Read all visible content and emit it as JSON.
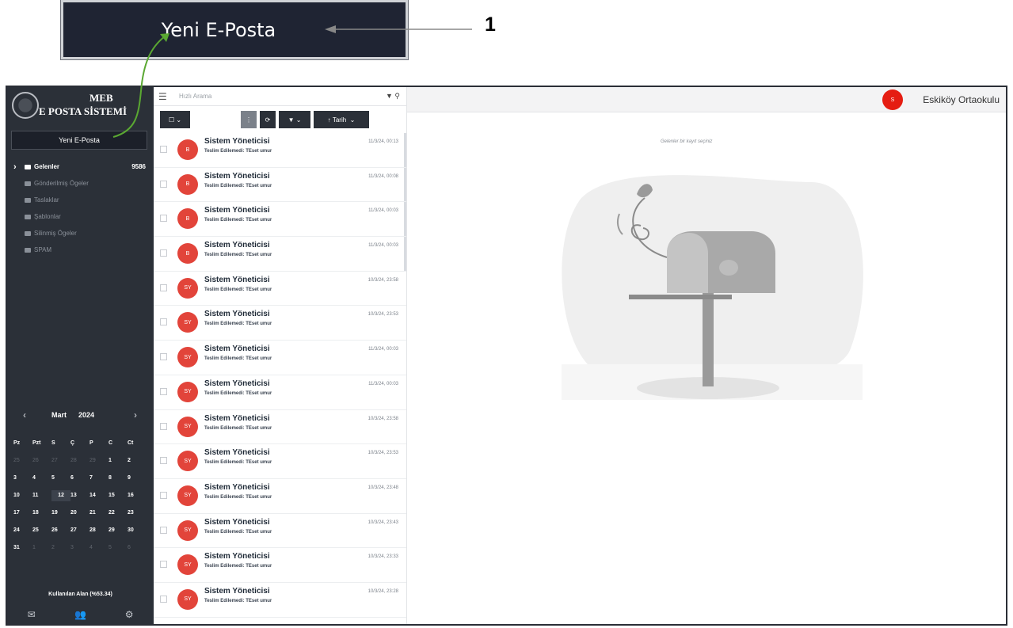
{
  "callout": {
    "button_label": "Yeni E-Posta",
    "number": "1"
  },
  "logo": {
    "line1": "MEB",
    "line2": "E POSTA SİSTEMİ"
  },
  "sidebar": {
    "new_mail_label": "Yeni E-Posta",
    "folders": [
      {
        "label": "Gelenler",
        "count": "9586",
        "icon": "inbox-icon",
        "active": true
      },
      {
        "label": "Gönderilmiş Ögeler",
        "icon": "sent-icon"
      },
      {
        "label": "Taslaklar",
        "icon": "drafts-icon"
      },
      {
        "label": "Şablonlar",
        "icon": "templates-icon"
      },
      {
        "label": "Silinmiş Ögeler",
        "icon": "trash-icon"
      },
      {
        "label": "SPAM",
        "icon": "spam-folder-icon"
      }
    ],
    "quota": "Kullanılan Alan (%53.34)"
  },
  "calendar": {
    "month": "Mart",
    "year": "2024",
    "weekdays": [
      "Pz",
      "Pzt",
      "S",
      "Ç",
      "P",
      "C",
      "Ct"
    ],
    "weeks": [
      [
        "25",
        "26",
        "27",
        "28",
        "29",
        "1",
        "2"
      ],
      [
        "3",
        "4",
        "5",
        "6",
        "7",
        "8",
        "9"
      ],
      [
        "10",
        "11",
        "12",
        "13",
        "14",
        "15",
        "16"
      ],
      [
        "17",
        "18",
        "19",
        "20",
        "21",
        "22",
        "23"
      ],
      [
        "24",
        "25",
        "26",
        "27",
        "28",
        "29",
        "30"
      ],
      [
        "31",
        "1",
        "2",
        "3",
        "4",
        "5",
        "6"
      ]
    ],
    "today": "12"
  },
  "list": {
    "search_placeholder": "Hızlı Arama",
    "sort_label": "Tarih",
    "messages": [
      {
        "initials": "B",
        "from": "Sistem Yöneticisi",
        "subject": "Teslim Edilemedi: TEset umur",
        "date": "11/3/24, 00:13"
      },
      {
        "initials": "B",
        "from": "Sistem Yöneticisi",
        "subject": "Teslim Edilemedi: TEset umur",
        "date": "11/3/24, 00:08"
      },
      {
        "initials": "B",
        "from": "Sistem Yöneticisi",
        "subject": "Teslim Edilemedi: TEset umur",
        "date": "11/3/24, 00:03"
      },
      {
        "initials": "B",
        "from": "Sistem Yöneticisi",
        "subject": "Teslim Edilemedi: TEset umur",
        "date": "11/3/24, 00:03"
      },
      {
        "initials": "SY",
        "from": "Sistem Yöneticisi",
        "subject": "Teslim Edilemedi: TEset umur",
        "date": "10/3/24, 23:58"
      },
      {
        "initials": "SY",
        "from": "Sistem Yöneticisi",
        "subject": "Teslim Edilemedi: TEset umur",
        "date": "10/3/24, 23:53"
      },
      {
        "initials": "SY",
        "from": "Sistem Yöneticisi",
        "subject": "Teslim Edilemedi: TEset umur",
        "date": "11/3/24, 00:03"
      },
      {
        "initials": "SY",
        "from": "Sistem Yöneticisi",
        "subject": "Teslim Edilemedi: TEset umur",
        "date": "11/3/24, 00:03"
      },
      {
        "initials": "SY",
        "from": "Sistem Yöneticisi",
        "subject": "Teslim Edilemedi: TEset umur",
        "date": "10/3/24, 23:58"
      },
      {
        "initials": "SY",
        "from": "Sistem Yöneticisi",
        "subject": "Teslim Edilemedi: TEset umur",
        "date": "10/3/24, 23:53"
      },
      {
        "initials": "SY",
        "from": "Sistem Yöneticisi",
        "subject": "Teslim Edilemedi: TEset umur",
        "date": "10/3/24, 23:48"
      },
      {
        "initials": "SY",
        "from": "Sistem Yöneticisi",
        "subject": "Teslim Edilemedi: TEset umur",
        "date": "10/3/24, 23:43"
      },
      {
        "initials": "SY",
        "from": "Sistem Yöneticisi",
        "subject": "Teslim Edilemedi: TEset umur",
        "date": "10/3/24, 23:33"
      },
      {
        "initials": "SY",
        "from": "Sistem Yöneticisi",
        "subject": "Teslim Edilemedi: TEset umur",
        "date": "10/3/24, 23:28"
      }
    ]
  },
  "pane": {
    "user_initial": "S",
    "user_name": "Eskiköy Ortaokulu",
    "hint": "Gelenler bir kayıt seçiniz"
  },
  "colors": {
    "sidebar_bg": "#2b3038",
    "avatar_red": "#e2443a",
    "user_red": "#e51d12",
    "callout_arrow": "#5aa832"
  }
}
